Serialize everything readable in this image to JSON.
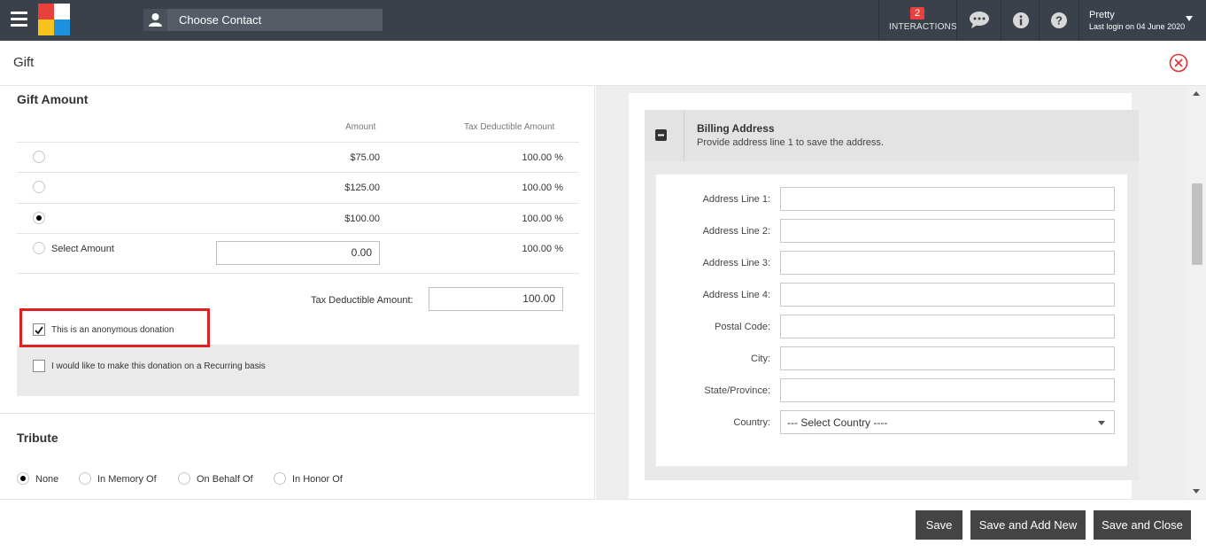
{
  "topbar": {
    "contact_placeholder": "Choose Contact",
    "interactions_count": "2",
    "interactions_label": "INTERACTIONS",
    "user_name": "Pretty",
    "last_login": "Last login on 04 June 2020",
    "icons": [
      "menu-icon",
      "app-logo",
      "user-icon",
      "chat-icon",
      "info-icon",
      "help-icon",
      "caret-down-icon"
    ],
    "logo_colors": [
      "#e8403a",
      "#ffffff",
      "#f7c31a",
      "#1e90e0"
    ]
  },
  "page": {
    "title": "Gift"
  },
  "gift_amount": {
    "title": "Gift Amount",
    "col_amount": "Amount",
    "col_tax": "Tax Deductible Amount",
    "rows": [
      {
        "amount": "$75.00",
        "tax": "100.00 %",
        "selected": false
      },
      {
        "amount": "$125.00",
        "tax": "100.00 %",
        "selected": false
      },
      {
        "amount": "$100.00",
        "tax": "100.00 %",
        "selected": true
      }
    ],
    "select_amount_label": "Select Amount",
    "select_amount_value": "0.00",
    "select_amount_tax": "100.00 %",
    "tax_deductible_label": "Tax Deductible Amount:",
    "tax_deductible_value": "100.00",
    "anonymous_label": "This is an anonymous donation",
    "anonymous_checked": true,
    "recurring_label": "I would like to make this donation on a Recurring basis",
    "recurring_checked": false
  },
  "tribute": {
    "title": "Tribute",
    "options": [
      "None",
      "In Memory Of",
      "On Behalf Of",
      "In Honor Of"
    ],
    "selected": "None"
  },
  "billing": {
    "title": "Billing Address",
    "subtitle": "Provide address line 1 to save the address.",
    "fields": [
      {
        "label": "Address Line 1:",
        "value": ""
      },
      {
        "label": "Address Line 2:",
        "value": ""
      },
      {
        "label": "Address Line 3:",
        "value": ""
      },
      {
        "label": "Address Line 4:",
        "value": ""
      },
      {
        "label": "Postal Code:",
        "value": ""
      },
      {
        "label": "City:",
        "value": ""
      },
      {
        "label": "State/Province:",
        "value": ""
      }
    ],
    "country_label": "Country:",
    "country_value": "--- Select Country ----"
  },
  "footer": {
    "save": "Save",
    "save_add_new": "Save and Add New",
    "save_close": "Save and Close"
  },
  "colors": {
    "topbar": "#3b414a",
    "button": "#444444",
    "highlight": "#e02020",
    "badge": "#e94040",
    "close": "#e03030"
  }
}
